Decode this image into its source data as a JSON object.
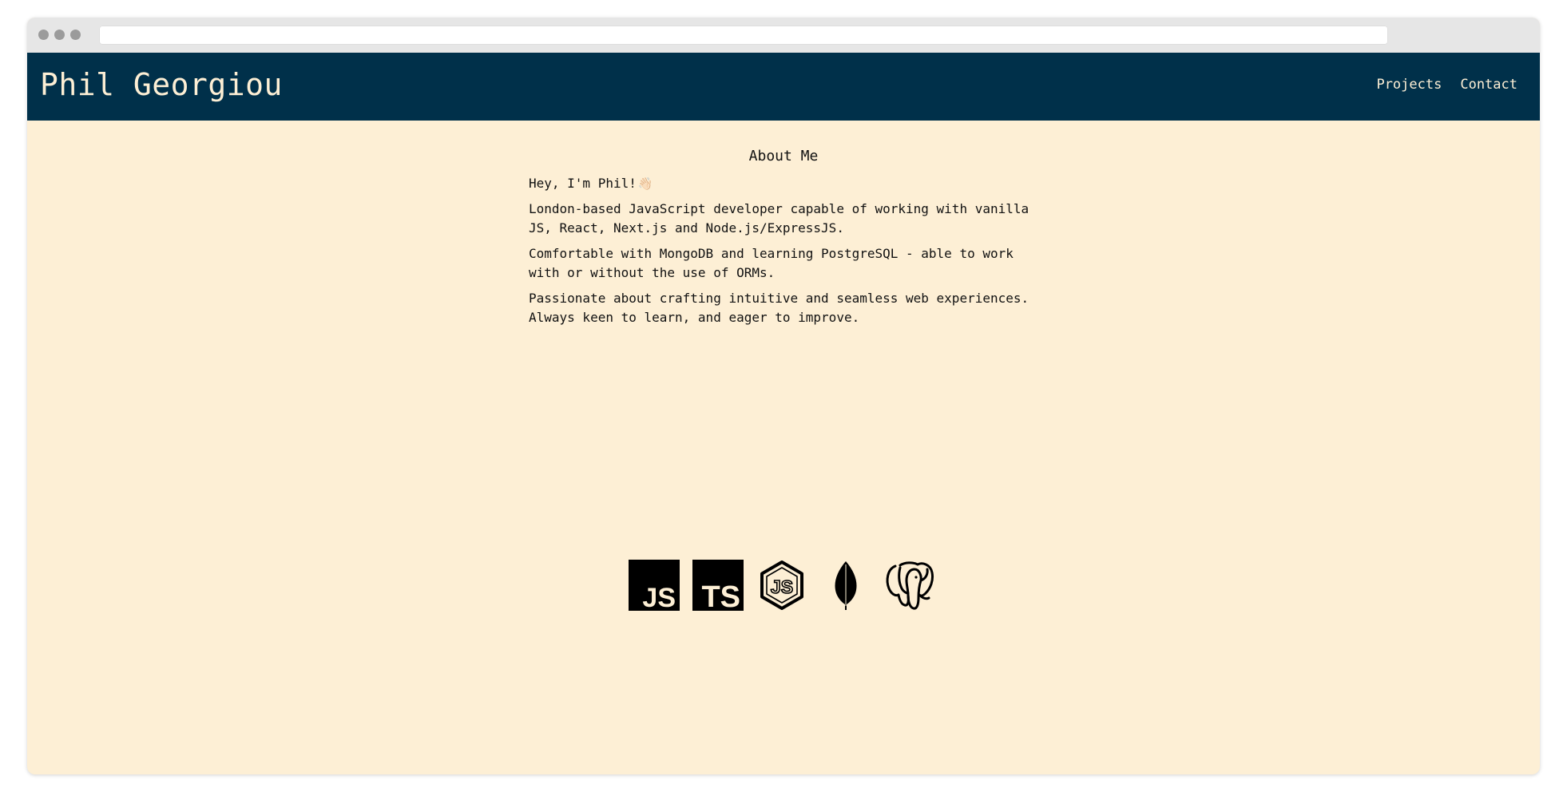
{
  "header": {
    "site_title": "Phil Georgiou",
    "nav": [
      "Projects",
      "Contact"
    ]
  },
  "about": {
    "title": "About Me",
    "greeting": "Hey, I'm Phil!",
    "greeting_emoji": "👋🏻",
    "paragraphs": [
      "London-based JavaScript developer capable of working with vanilla\nJS, React, Next.js and Node.js/ExpressJS.",
      "Comfortable with MongoDB and learning PostgreSQL - able to work\nwith or without the use of ORMs.",
      "Passionate about crafting intuitive and seamless web experiences.\nAlways keen to learn, and eager to improve."
    ]
  },
  "tech_icons": {
    "javascript": "JS",
    "typescript": "TS",
    "nodejs": "JS",
    "mongodb": "mongodb-leaf-icon",
    "postgresql": "postgresql-elephant-icon"
  },
  "colors": {
    "nav_background": "#00304a",
    "page_background": "#fdefd5",
    "nav_text": "#fdefd5",
    "body_text": "#111111",
    "icon": "#000000"
  }
}
